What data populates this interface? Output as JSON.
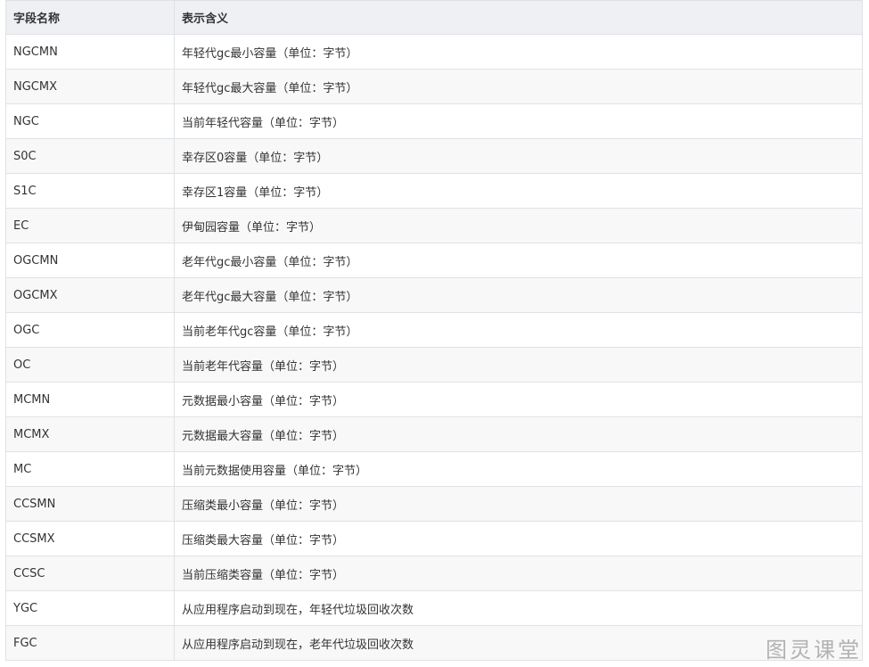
{
  "table": {
    "headers": [
      "字段名称",
      "表示含义"
    ],
    "rows": [
      [
        "NGCMN",
        "年轻代gc最小容量（单位：字节）"
      ],
      [
        "NGCMX",
        "年轻代gc最大容量（单位：字节）"
      ],
      [
        "NGC",
        "当前年轻代容量（单位：字节）"
      ],
      [
        "S0C",
        "幸存区0容量（单位：字节）"
      ],
      [
        "S1C",
        "幸存区1容量（单位：字节）"
      ],
      [
        "EC",
        "伊甸园容量（单位：字节）"
      ],
      [
        "OGCMN",
        "老年代gc最小容量（单位：字节）"
      ],
      [
        "OGCMX",
        "老年代gc最大容量（单位：字节）"
      ],
      [
        "OGC",
        "当前老年代gc容量（单位：字节）"
      ],
      [
        "OC",
        "当前老年代容量（单位：字节）"
      ],
      [
        "MCMN",
        "元数据最小容量（单位：字节）"
      ],
      [
        "MCMX",
        "元数据最大容量（单位：字节）"
      ],
      [
        "MC",
        "当前元数据使用容量（单位：字节）"
      ],
      [
        "CCSMN",
        "压缩类最小容量（单位：字节）"
      ],
      [
        "CCSMX",
        "压缩类最大容量（单位：字节）"
      ],
      [
        "CCSC",
        "当前压缩类容量（单位：字节）"
      ],
      [
        "YGC",
        "从应用程序启动到现在，年轻代垃圾回收次数"
      ],
      [
        "FGC",
        "从应用程序启动到现在，老年代垃圾回收次数"
      ]
    ]
  },
  "watermark": "图灵课堂"
}
